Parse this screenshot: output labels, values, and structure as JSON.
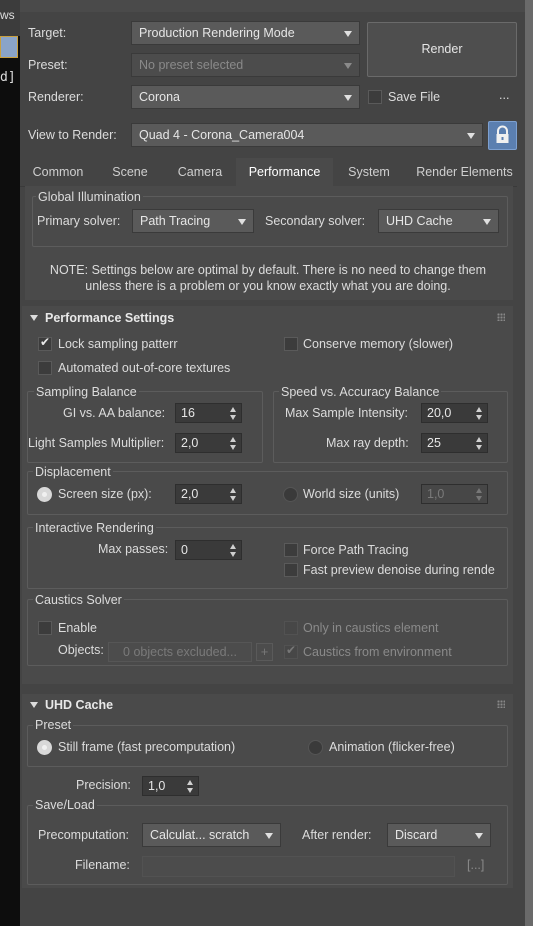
{
  "window": {
    "left_edge_text_top": "ws",
    "left_edge_text_mid": "d]"
  },
  "header": {
    "target_label": "Target:",
    "target_value": "Production Rendering Mode",
    "preset_label": "Preset:",
    "preset_value": "No preset selected",
    "renderer_label": "Renderer:",
    "renderer_value": "Corona",
    "save_file_label": "Save File",
    "more_label": "...",
    "render_button": "Render",
    "view_label": "View to Render:",
    "view_value": "Quad 4 - Corona_Camera004"
  },
  "tabs": [
    {
      "label": "Common"
    },
    {
      "label": "Scene"
    },
    {
      "label": "Camera"
    },
    {
      "label": "Performance"
    },
    {
      "label": "System"
    },
    {
      "label": "Render Elements"
    }
  ],
  "gi": {
    "title": "Global Illumination",
    "primary_label": "Primary solver:",
    "primary_value": "Path Tracing",
    "secondary_label": "Secondary solver:",
    "secondary_value": "UHD Cache",
    "note_line1": "NOTE: Settings below are optimal by default. There is no need to change them",
    "note_line2": "unless there is a problem or you know exactly what you are doing."
  },
  "perf": {
    "title": "Performance Settings",
    "lock_sampling": "Lock sampling patterr",
    "conserve_memory": "Conserve memory (slower)",
    "auto_ooc": "Automated out-of-core textures",
    "sampling_balance_title": "Sampling Balance",
    "gi_aa_label": "GI vs. AA balance:",
    "gi_aa_value": "16",
    "light_mult_label": "Light Samples Multiplier:",
    "light_mult_value": "2,0",
    "speed_title": "Speed vs. Accuracy Balance",
    "max_intensity_label": "Max Sample Intensity:",
    "max_intensity_value": "20,0",
    "max_ray_label": "Max ray depth:",
    "max_ray_value": "25",
    "displacement_title": "Displacement",
    "screen_size_label": "Screen size (px):",
    "screen_size_value": "2,0",
    "world_size_label": "World size (units)",
    "world_size_value": "1,0",
    "interactive_title": "Interactive Rendering",
    "max_passes_label": "Max passes:",
    "max_passes_value": "0",
    "force_pt": "Force Path Tracing",
    "fast_denoise": "Fast preview denoise during rende",
    "caustics_title": "Caustics Solver",
    "enable": "Enable",
    "only_caustics": "Only in caustics element",
    "objects_label": "Objects:",
    "objects_value": "0 objects excluded...",
    "plus": "+",
    "caustics_env": "Caustics from environment"
  },
  "uhd": {
    "title": "UHD Cache",
    "preset_title": "Preset",
    "still_frame": "Still frame (fast precomputation)",
    "animation": "Animation (flicker-free)",
    "precision_label": "Precision:",
    "precision_value": "1,0",
    "saveload_title": "Save/Load",
    "precomp_label": "Precomputation:",
    "precomp_value": "Calculat... scratch",
    "after_label": "After render:",
    "after_value": "Discard",
    "filename_label": "Filename:",
    "browse": "[...]"
  }
}
